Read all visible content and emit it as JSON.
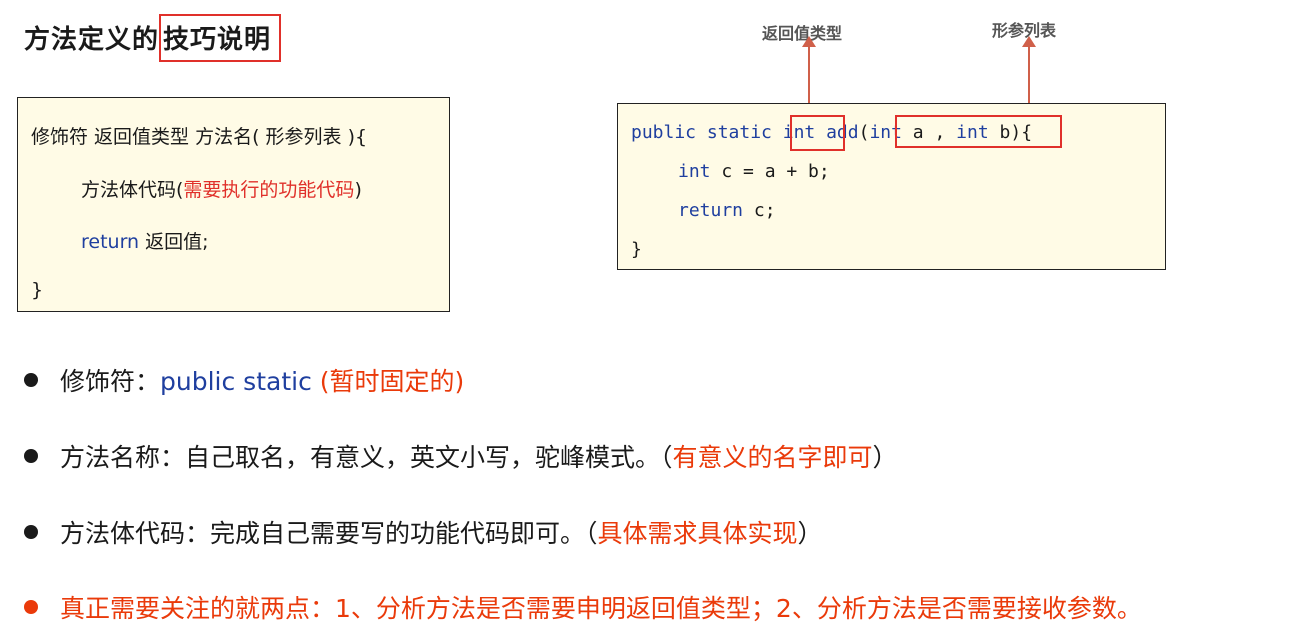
{
  "title": {
    "prefix": "方法定义的",
    "highlight": "技巧说明"
  },
  "syntax_box": {
    "line1": "修饰符  返回值类型  方法名( 形参列表 ){",
    "line2_prefix": "方法体代码(",
    "line2_red": "需要执行的功能代码",
    "line2_suffix": ")",
    "line3_keyword": "return",
    "line3_rest": " 返回值;",
    "line4": "}"
  },
  "annotations": {
    "return_type": "返回值类型",
    "param_list": "形参列表"
  },
  "code_box": {
    "l1_kw": "public static",
    "l1_int": "int",
    "l1_add": "add",
    "l1_open": "(",
    "l1_int2": "int",
    "l1_a": " a , ",
    "l1_int3": "int",
    "l1_b": " b",
    "l1_close": "){",
    "l2_int": "int",
    "l2_rest": " c = a + b;",
    "l3_return": "return",
    "l3_rest": " c;",
    "l4": "}"
  },
  "bullets": [
    {
      "label": "修饰符：",
      "blue": "public static ",
      "red": "(暂时固定的)"
    },
    {
      "label": "方法名称：自己取名，有意义，英文小写，驼峰模式。（",
      "red": "有意义的名字即可",
      "suffix": "）"
    },
    {
      "label": "方法体代码：完成自己需要写的功能代码即可。（",
      "red": "具体需求具体实现",
      "suffix": "）"
    },
    {
      "red": "真正需要关注的就两点：1、分析方法是否需要申明返回值类型；2、分析方法是否需要接收参数。"
    }
  ],
  "colors": {
    "accent_red": "#e0302a",
    "keyword_blue": "#1f3f9f",
    "box_bg": "#fffbe6",
    "highlight_orange": "#ea3a0a"
  }
}
